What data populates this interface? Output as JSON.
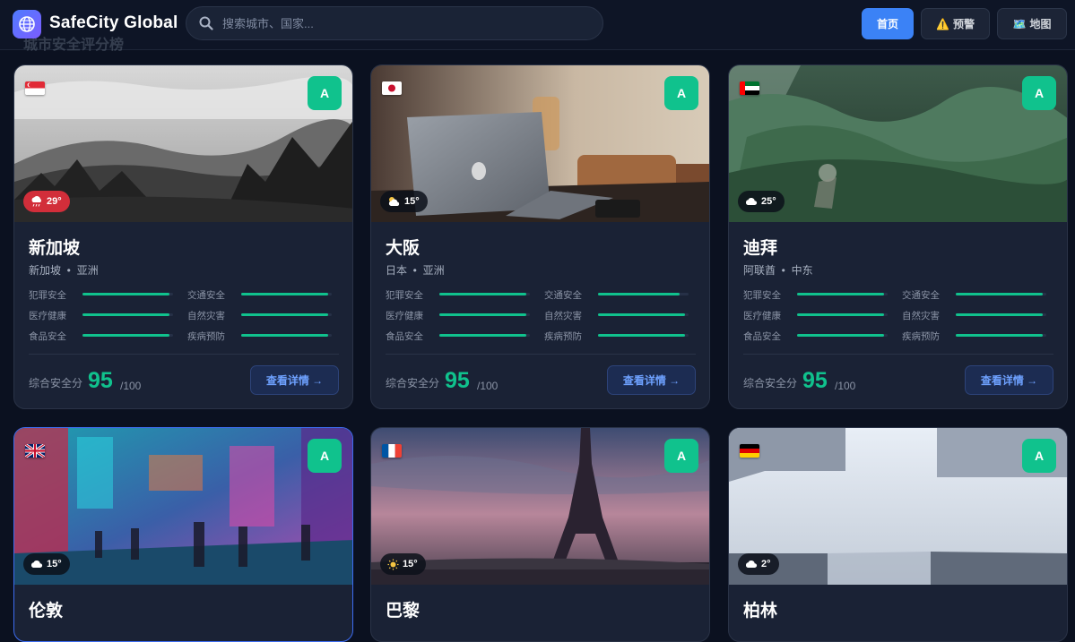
{
  "header": {
    "app_title": "SafeCity Global",
    "background_heading": "城市安全评分榜",
    "search_placeholder": "搜索城市、国家...",
    "nav": [
      {
        "label": "首页",
        "icon": "",
        "active": true
      },
      {
        "label": "预警",
        "icon": "⚠️",
        "active": false
      },
      {
        "label": "地图",
        "icon": "🗺️",
        "active": false
      }
    ]
  },
  "metric_labels": [
    "犯罪安全",
    "交通安全",
    "医疗健康",
    "自然灾害",
    "食品安全",
    "疾病预防"
  ],
  "score_label": "综合安全分",
  "score_max": "/100",
  "detail_label": "查看详情 →",
  "colors": {
    "accent": "#3b82f6",
    "grade_green": "#10c28d",
    "hot_weather": "#d22e3a",
    "card_bg": "#1a2235",
    "page_bg": "#0b1120"
  },
  "cities": [
    {
      "name": "新加坡",
      "country": "新加坡",
      "continent": "亚洲",
      "grade": "A",
      "weather": "29°",
      "weather_icon": "rain-cloud-icon",
      "weather_hot": true,
      "flag": "singapore-flag",
      "score": "95",
      "metrics": [
        0.96,
        0.96,
        0.96,
        0.96,
        0.96,
        0.96
      ]
    },
    {
      "name": "大阪",
      "country": "日本",
      "continent": "亚洲",
      "grade": "A",
      "weather": "15°",
      "weather_icon": "partly-cloudy-icon",
      "weather_hot": false,
      "flag": "japan-flag",
      "score": "95",
      "metrics": [
        0.96,
        0.9,
        0.96,
        0.96,
        0.96,
        0.96
      ]
    },
    {
      "name": "迪拜",
      "country": "阿联酋",
      "continent": "中东",
      "grade": "A",
      "weather": "25°",
      "weather_icon": "cloud-icon",
      "weather_hot": false,
      "flag": "uae-flag",
      "score": "95",
      "metrics": [
        0.96,
        0.96,
        0.96,
        0.96,
        0.96,
        0.96
      ]
    },
    {
      "name": "伦敦",
      "country": "",
      "continent": "",
      "grade": "A",
      "weather": "15°",
      "weather_icon": "cloud-icon",
      "weather_hot": false,
      "flag": "uk-flag",
      "score": "",
      "metrics": []
    },
    {
      "name": "巴黎",
      "country": "",
      "continent": "",
      "grade": "A",
      "weather": "15°",
      "weather_icon": "sun-icon",
      "weather_hot": false,
      "flag": "france-flag",
      "score": "",
      "metrics": []
    },
    {
      "name": "柏林",
      "country": "",
      "continent": "",
      "grade": "A",
      "weather": "2°",
      "weather_icon": "cloud-icon",
      "weather_hot": false,
      "flag": "germany-flag",
      "score": "",
      "metrics": []
    }
  ]
}
